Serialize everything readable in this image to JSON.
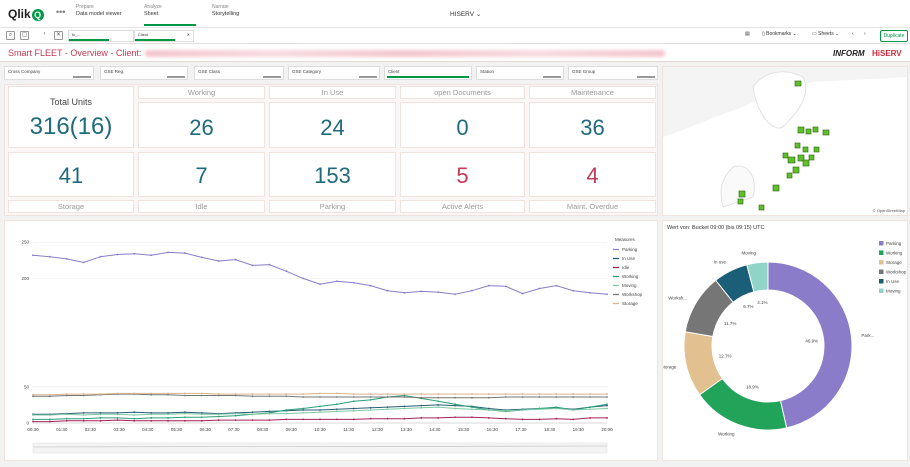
{
  "app": {
    "logo": "Qlik",
    "tabs": [
      {
        "label": "Prepare",
        "sub": "Data model viewer"
      },
      {
        "label": "Analyze",
        "sub": "Sheet"
      },
      {
        "label": "Narrate",
        "sub": "Storytelling"
      }
    ],
    "app_name": "HISERV"
  },
  "toolbar": {
    "selections": [
      {
        "label": "fc_...",
        "value": "..."
      },
      {
        "label": "Client",
        "value": "..."
      }
    ],
    "bookmarks": "Bookmarks",
    "sheets": "Sheets",
    "duplicate": "Duplicate"
  },
  "sheet": {
    "title": "Smart FLEET - Overview - Client:",
    "brand1": "INFORM",
    "brand2": "HiSERV"
  },
  "filters": [
    "Cross Company",
    "GSE Reg.",
    "GSE Class",
    "GSE Category",
    "Client",
    "Station",
    "GSE Group"
  ],
  "kpis_top": [
    {
      "title": "Total Units",
      "value": "316(16)"
    },
    {
      "title": "Working",
      "value": "26"
    },
    {
      "title": "In Use",
      "value": "24"
    },
    {
      "title": "open Documents",
      "value": "0"
    },
    {
      "title": "Maintenance",
      "value": "36"
    }
  ],
  "kpis_bottom": [
    {
      "title": "Storage",
      "value": "41"
    },
    {
      "title": "Idle",
      "value": "7"
    },
    {
      "title": "Parking",
      "value": "153"
    },
    {
      "title": "Active Alerts",
      "value": "5"
    },
    {
      "title": "Maint. Overdue",
      "value": "4"
    }
  ],
  "map": {
    "attribution": "© OpenStreetMap"
  },
  "chart_data": [
    {
      "type": "line",
      "title": "",
      "legend_title": "Measures",
      "legend_position": "right",
      "ylim": [
        0,
        260
      ],
      "y_ticks": [
        0,
        50,
        200,
        250
      ],
      "x": [
        "00:00",
        "",
        "",
        "",
        "",
        "",
        "",
        "",
        "",
        "",
        "",
        "",
        "",
        "",
        "",
        "",
        "",
        "",
        "",
        "",
        "",
        "",
        "",
        "",
        "",
        "",
        "",
        "",
        "",
        "",
        "",
        "",
        "",
        "",
        ""
      ],
      "x_tick_labels": [
        "00:30",
        "01:30",
        "02:30",
        "03:30",
        "04:30",
        "05:30",
        "06:30",
        "07:30",
        "08:30",
        "09:30",
        "10:30",
        "11:30",
        "12:30",
        "13:30",
        "14:30",
        "15:30",
        "16:30",
        "17:30",
        "18:30",
        "19:30",
        "20:00"
      ],
      "series": [
        {
          "name": "Parking",
          "color": "#8a7cc8",
          "values": [
            232,
            230,
            227,
            222,
            230,
            233,
            234,
            232,
            236,
            235,
            229,
            224,
            226,
            218,
            219,
            210,
            200,
            192,
            196,
            194,
            190,
            183,
            180,
            182,
            181,
            178,
            183,
            190,
            189,
            179,
            186,
            190,
            183,
            180,
            178
          ]
        },
        {
          "name": "In Use",
          "color": "#2a5f73",
          "values": [
            12,
            12,
            13,
            14,
            14,
            14,
            15,
            14,
            14,
            15,
            14,
            13,
            14,
            15,
            16,
            17,
            18,
            18,
            19,
            20,
            21,
            22,
            23,
            24,
            25,
            24,
            23,
            20,
            18,
            19,
            20,
            21,
            19,
            22,
            24
          ]
        },
        {
          "name": "Idle",
          "color": "#a3245a",
          "values": [
            2,
            2,
            3,
            3,
            3,
            4,
            3,
            3,
            3,
            3,
            3,
            4,
            4,
            4,
            4,
            5,
            5,
            5,
            5,
            5,
            6,
            6,
            6,
            7,
            7,
            8,
            8,
            7,
            6,
            5,
            5,
            6,
            5,
            7,
            7
          ]
        },
        {
          "name": "Working",
          "color": "#2ba07b",
          "values": [
            5,
            5,
            6,
            6,
            7,
            7,
            6,
            7,
            7,
            8,
            8,
            9,
            10,
            12,
            14,
            18,
            20,
            23,
            26,
            30,
            32,
            36,
            38,
            34,
            30,
            26,
            22,
            18,
            16,
            18,
            20,
            22,
            18,
            22,
            26
          ]
        },
        {
          "name": "Moving",
          "color": "#7fc9a7",
          "values": [
            11,
            11,
            12,
            11,
            12,
            12,
            11,
            12,
            12,
            13,
            12,
            12,
            13,
            12,
            13,
            13,
            14,
            15,
            16,
            17,
            18,
            19,
            20,
            21,
            22,
            20,
            19,
            18,
            17,
            18,
            19,
            20,
            18,
            19,
            20
          ]
        },
        {
          "name": "Workshop",
          "color": "#777777",
          "values": [
            37,
            37,
            38,
            38,
            39,
            40,
            40,
            39,
            39,
            38,
            38,
            38,
            38,
            37,
            37,
            37,
            36,
            36,
            36,
            36,
            36,
            36,
            36,
            35,
            35,
            35,
            35,
            35,
            36,
            36,
            36,
            36,
            36,
            36,
            36
          ]
        },
        {
          "name": "Storage",
          "color": "#d9b48f",
          "values": [
            39,
            39,
            40,
            40,
            40,
            41,
            41,
            41,
            41,
            41,
            41,
            40,
            40,
            40,
            40,
            40,
            40,
            41,
            41,
            40,
            40,
            40,
            40,
            40,
            40,
            40,
            40,
            40,
            40,
            40,
            40,
            40,
            40,
            40,
            40
          ]
        }
      ]
    },
    {
      "type": "pie",
      "title": "Wert von: Bucket 09:00 (bis 09:15) UTC",
      "legend_position": "right",
      "slices": [
        {
          "name": "Parking",
          "value": 46.9,
          "color": "#8a7cc8",
          "outer_label": "Park...",
          "pct_label": "46.9%"
        },
        {
          "name": "Working",
          "value": 18.9,
          "color": "#22a35a",
          "outer_label": "Working",
          "pct_label": "18.9%"
        },
        {
          "name": "Storage",
          "value": 12.7,
          "color": "#e2c08f",
          "outer_label": "Storage",
          "pct_label": "12.7%"
        },
        {
          "name": "Workshop",
          "value": 11.7,
          "color": "#767676",
          "outer_label": "Worksh...",
          "pct_label": "11.7%"
        },
        {
          "name": "In Use",
          "value": 6.7,
          "color": "#1a5e78",
          "outer_label": "In use",
          "pct_label": "6.7%"
        },
        {
          "name": "Moving",
          "value": 4.1,
          "color": "#8fd4c6",
          "outer_label": "Moving",
          "pct_label": "4.1%"
        }
      ]
    }
  ]
}
